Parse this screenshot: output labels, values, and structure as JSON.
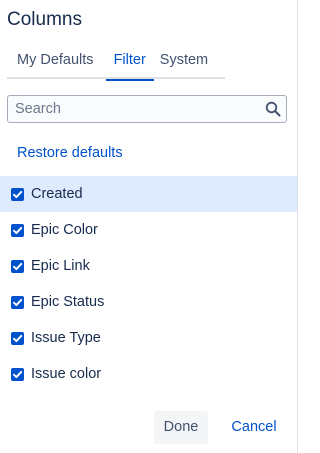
{
  "dialog": {
    "title": "Columns"
  },
  "tabs": [
    {
      "label": "My Defaults",
      "active": false
    },
    {
      "label": "Filter",
      "active": true
    },
    {
      "label": "System",
      "active": false
    }
  ],
  "search": {
    "placeholder": "Search",
    "value": "",
    "icon": "search-icon"
  },
  "restore_defaults_label": "Restore defaults",
  "columns": [
    {
      "label": "Created",
      "checked": true,
      "highlighted": true
    },
    {
      "label": "Epic Color",
      "checked": true,
      "highlighted": false
    },
    {
      "label": "Epic Link",
      "checked": true,
      "highlighted": false
    },
    {
      "label": "Epic Status",
      "checked": true,
      "highlighted": false
    },
    {
      "label": "Issue Type",
      "checked": true,
      "highlighted": false
    },
    {
      "label": "Issue color",
      "checked": true,
      "highlighted": false
    }
  ],
  "footer": {
    "done_label": "Done",
    "cancel_label": "Cancel"
  },
  "colors": {
    "accent": "#0052cc",
    "highlight_row": "#deebff",
    "text": "#172b4d"
  }
}
